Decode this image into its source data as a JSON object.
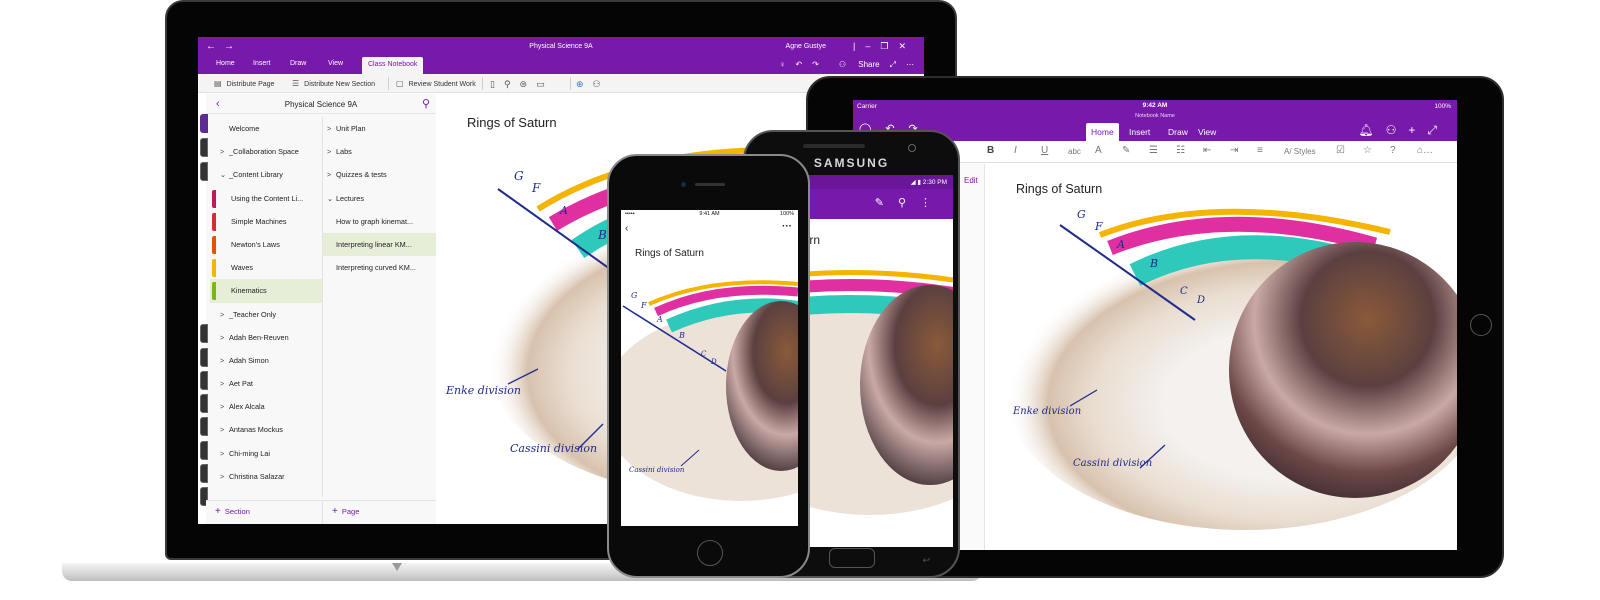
{
  "laptop": {
    "window_title": "Physical Science 9A",
    "user_name": "Agne Gustye",
    "nav_back_icon": "arrow-left-icon",
    "nav_forward_icon": "arrow-right-icon",
    "window_controls": [
      "minimize",
      "restore",
      "close"
    ],
    "tabs": [
      {
        "label": "Home",
        "active": false
      },
      {
        "label": "Insert",
        "active": false
      },
      {
        "label": "Draw",
        "active": false
      },
      {
        "label": "View",
        "active": false
      },
      {
        "label": "Class Notebook",
        "active": true
      }
    ],
    "tabbar_right": {
      "share_label": "Share",
      "icons": [
        "lightbulb-icon",
        "undo-icon",
        "redo-icon",
        "person-icon",
        "expand-icon",
        "more-icon"
      ]
    },
    "ribbon": [
      {
        "label": "Distribute Page",
        "icon": "distribute-page-icon"
      },
      {
        "label": "Distribute New Section",
        "icon": "distribute-section-icon"
      },
      {
        "label": "Review Student Work",
        "icon": "review-icon"
      }
    ],
    "ribbon_icons": [
      "notebook-icon",
      "person-icon",
      "graduation-cap-icon",
      "page-icon",
      "globe-search-icon",
      "teams-icon"
    ],
    "notebook_pane": {
      "title": "Physical Science 9A",
      "sections": [
        {
          "label": "Welcome",
          "chevron": "",
          "level": 0,
          "color": "#5c2d91"
        },
        {
          "label": "_Collaboration Space",
          "chevron": ">",
          "level": 0,
          "color": "#444444"
        },
        {
          "label": "_Content Library",
          "chevron": "v",
          "level": 0,
          "color": "#444444"
        },
        {
          "label": "Using the Content Li...",
          "chevron": "",
          "level": 1,
          "color": "#c2185b"
        },
        {
          "label": "Simple Machines",
          "chevron": "",
          "level": 1,
          "color": "#d32f2f"
        },
        {
          "label": "Newton's Laws",
          "chevron": "",
          "level": 1,
          "color": "#e65100"
        },
        {
          "label": "Waves",
          "chevron": "",
          "level": 1,
          "color": "#f2b705"
        },
        {
          "label": "Kinematics",
          "chevron": "",
          "level": 1,
          "color": "#7cb518",
          "selected": true
        },
        {
          "label": "_Teacher Only",
          "chevron": ">",
          "level": 0,
          "color": "#444444"
        },
        {
          "label": "Adah Ben-Reuven",
          "chevron": ">",
          "level": 0,
          "color": "#444444"
        },
        {
          "label": "Adah Simon",
          "chevron": ">",
          "level": 0,
          "color": "#444444"
        },
        {
          "label": "Aet Pat",
          "chevron": ">",
          "level": 0,
          "color": "#444444"
        },
        {
          "label": "Alex Alcala",
          "chevron": ">",
          "level": 0,
          "color": "#444444"
        },
        {
          "label": "Antanas Mockus",
          "chevron": ">",
          "level": 0,
          "color": "#444444"
        },
        {
          "label": "Chi-ming Lai",
          "chevron": ">",
          "level": 0,
          "color": "#444444"
        },
        {
          "label": "Christina Salazar",
          "chevron": ">",
          "level": 0,
          "color": "#444444"
        }
      ],
      "pages": [
        {
          "label": "Unit Plan",
          "chevron": ">",
          "group": true
        },
        {
          "label": "Labs",
          "chevron": ">",
          "group": true
        },
        {
          "label": "Quizzes & tests",
          "chevron": ">",
          "group": true
        },
        {
          "label": "Lectures",
          "chevron": "v",
          "group": true
        },
        {
          "label": "How to graph kinemat...",
          "chevron": "",
          "group": false
        },
        {
          "label": "Interpreting linear KM...",
          "chevron": "",
          "group": false,
          "selected": true
        },
        {
          "label": "Interpreting curved KM...",
          "chevron": "",
          "group": false
        }
      ],
      "add_section_label": "Section",
      "add_page_label": "Page"
    },
    "page": {
      "title": "Rings of Saturn"
    }
  },
  "drawing": {
    "ring_labels": [
      "G",
      "F",
      "A",
      "B",
      "C",
      "D"
    ],
    "annotations": {
      "enke": "Enke division",
      "cassini": "Cassini division"
    },
    "ring_colors": {
      "g_ring": "#f5b400",
      "a_ring": "#e02fa0",
      "b_ring": "#2ec9bb",
      "ink": "#1f2b8c"
    }
  },
  "tablet": {
    "status": {
      "carrier": "Carrier",
      "time": "9:42 AM",
      "battery": "100%"
    },
    "notebook_name": "Notebook Name",
    "tabs": [
      {
        "label": "Home",
        "active": true
      },
      {
        "label": "Insert",
        "active": false
      },
      {
        "label": "Draw",
        "active": false
      },
      {
        "label": "View",
        "active": false
      }
    ],
    "header_icons_left": [
      "notebooks-icon",
      "undo-icon",
      "redo-icon"
    ],
    "header_icons_right": [
      "bell-icon",
      "add-person-icon",
      "fullscreen-icon"
    ],
    "toolbar": [
      {
        "glyph": "B",
        "name": "bold-button"
      },
      {
        "glyph": "I",
        "name": "italic-button"
      },
      {
        "glyph": "U",
        "name": "underline-button"
      },
      {
        "glyph": "abc",
        "name": "strikethrough-button"
      },
      {
        "glyph": "A",
        "name": "font-color-button"
      },
      {
        "glyph": "✎",
        "name": "highlight-button"
      },
      {
        "glyph": "☰",
        "name": "bullets-button"
      },
      {
        "glyph": "☷",
        "name": "numbering-button"
      },
      {
        "glyph": "⇤",
        "name": "outdent-button"
      },
      {
        "glyph": "⇥",
        "name": "indent-button"
      },
      {
        "glyph": "≡",
        "name": "align-button"
      },
      {
        "glyph": "A/ Styles",
        "name": "styles-button"
      },
      {
        "glyph": "☑",
        "name": "todo-button"
      },
      {
        "glyph": "☆",
        "name": "important-button"
      },
      {
        "glyph": "?",
        "name": "question-button"
      },
      {
        "glyph": "⌂…",
        "name": "tags-button"
      }
    ],
    "page": {
      "title": "Rings of Saturn"
    }
  },
  "android": {
    "brand": "SAMSUNG",
    "status_time": "2:30 PM",
    "edit_label": "Edit",
    "appbar_icons": [
      "pen-icon",
      "search-icon",
      "more-vert-icon"
    ],
    "page": {
      "title_fragment": "f Saturn"
    }
  },
  "iphone": {
    "status": {
      "signal": "•••••",
      "time": "9:41 AM",
      "battery": "100%"
    },
    "page": {
      "title": "Rings of Saturn"
    }
  }
}
